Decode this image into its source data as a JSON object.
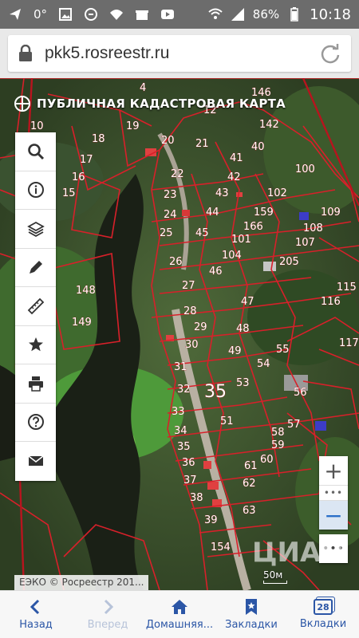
{
  "status_bar": {
    "temperature": "0°",
    "battery": "86%",
    "time": "10:18",
    "left_icons": [
      "send-icon",
      "gallery-icon",
      "sync-icon",
      "wifi-icon",
      "gift-icon",
      "youtube-icon"
    ],
    "right_icons": [
      "wifi-signal-icon",
      "cell-signal-icon",
      "battery-icon"
    ]
  },
  "browser": {
    "url": "pkk5.rosreestr.ru"
  },
  "map": {
    "title": "ПУБЛИЧНАЯ КАДАСТРОВАЯ КАРТА",
    "copyright": "ЕЭКО © Росреестр 201...",
    "scale": "50м",
    "zone_label": "35",
    "watermark": "ЦИАН",
    "parcels": [
      "4",
      "146",
      "12",
      "142",
      "10",
      "19",
      "20",
      "18",
      "21",
      "40",
      "17",
      "41",
      "100",
      "22",
      "16",
      "15",
      "42",
      "23",
      "43",
      "102",
      "24",
      "44",
      "159",
      "109",
      "45",
      "166",
      "108",
      "25",
      "101",
      "107",
      "104",
      "26",
      "205",
      "46",
      "115",
      "148",
      "27",
      "47",
      "116",
      "28",
      "48",
      "29",
      "149",
      "117",
      "30",
      "49",
      "55",
      "31",
      "53",
      "54",
      "32",
      "56",
      "33",
      "51",
      "34",
      "57",
      "58",
      "35",
      "59",
      "36",
      "60",
      "61",
      "37",
      "62",
      "38",
      "63",
      "39",
      "154"
    ],
    "zoom_in": "+",
    "zoom_out": "−",
    "zoom_separator": "•••",
    "more": "•••"
  },
  "toolbar": [
    "search-icon",
    "info-icon",
    "layers-icon",
    "pencil-icon",
    "ruler-icon",
    "star-icon",
    "print-icon",
    "help-icon",
    "mail-icon"
  ],
  "nav": {
    "back": "Назад",
    "forward": "Вперед",
    "home": "Домашняя...",
    "bookmarks": "Закладки",
    "tabs": "Вкладки",
    "tab_count": "28"
  },
  "colors": {
    "accent": "#2b56a6",
    "parcel_line": "#d8202a"
  }
}
